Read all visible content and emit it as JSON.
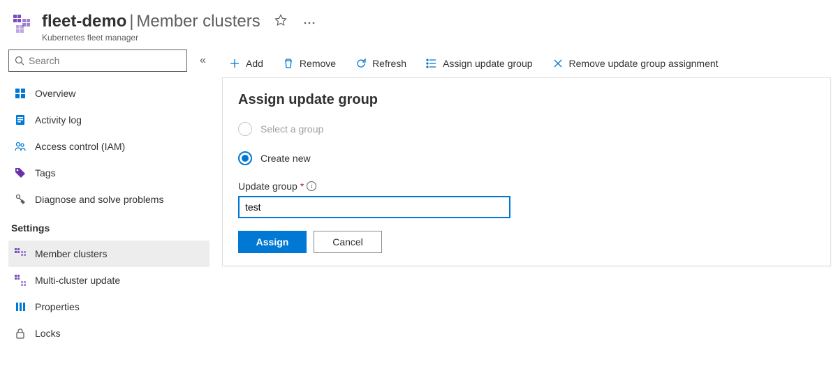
{
  "header": {
    "resource_name": "fleet-demo",
    "page_name": "Member clusters",
    "subtitle": "Kubernetes fleet manager"
  },
  "sidebar": {
    "search_placeholder": "Search",
    "items": [
      {
        "label": "Overview",
        "icon": "overview"
      },
      {
        "label": "Activity log",
        "icon": "activity-log"
      },
      {
        "label": "Access control (IAM)",
        "icon": "access-control"
      },
      {
        "label": "Tags",
        "icon": "tags"
      },
      {
        "label": "Diagnose and solve problems",
        "icon": "diagnose"
      }
    ],
    "section_label": "Settings",
    "settings_items": [
      {
        "label": "Member clusters",
        "icon": "member-clusters",
        "selected": true
      },
      {
        "label": "Multi-cluster update",
        "icon": "multi-cluster"
      },
      {
        "label": "Properties",
        "icon": "properties"
      },
      {
        "label": "Locks",
        "icon": "locks"
      }
    ]
  },
  "toolbar": {
    "add_label": "Add",
    "remove_label": "Remove",
    "refresh_label": "Refresh",
    "assign_label": "Assign update group",
    "remove_assign_label": "Remove update group assignment"
  },
  "panel": {
    "title": "Assign update group",
    "radio_select_label": "Select a group",
    "radio_create_label": "Create new",
    "field_label": "Update group",
    "input_value": "test",
    "assign_btn": "Assign",
    "cancel_btn": "Cancel"
  }
}
